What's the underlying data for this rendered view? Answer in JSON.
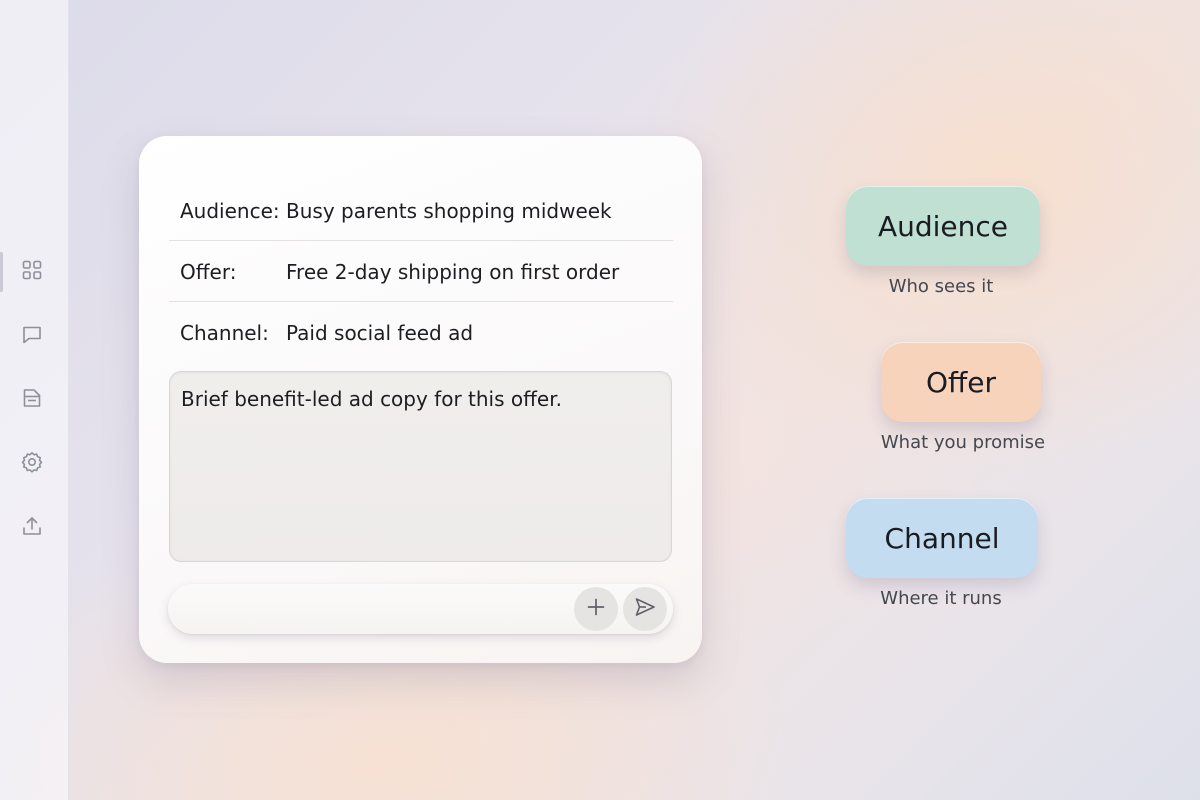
{
  "sidebar": {
    "items": [
      {
        "icon": "grid-icon"
      },
      {
        "icon": "chat-icon"
      },
      {
        "icon": "document-icon"
      },
      {
        "icon": "gear-icon"
      },
      {
        "icon": "upload-icon"
      }
    ]
  },
  "card": {
    "fields": [
      {
        "label": "Audience:",
        "value": "Busy parents shopping midweek"
      },
      {
        "label": "Offer:",
        "value": "Free 2-day shipping on first order"
      },
      {
        "label": "Channel:",
        "value": "Paid social feed ad"
      }
    ],
    "prompt_text": "Brief benefit-led ad copy for this offer.",
    "input_value": "",
    "add_icon": "plus-icon",
    "send_icon": "send-icon"
  },
  "pills": [
    {
      "label": "Audience",
      "caption": "Who sees it",
      "color": "#bfe0d3"
    },
    {
      "label": "Offer",
      "caption": "What you promise",
      "color": "#f7d3bb"
    },
    {
      "label": "Channel",
      "caption": "Where it runs",
      "color": "#c3dcf0"
    }
  ],
  "colors": {
    "audience_pill": "#bfe0d3",
    "offer_pill": "#f7d3bb",
    "channel_pill": "#c3dcf0"
  }
}
